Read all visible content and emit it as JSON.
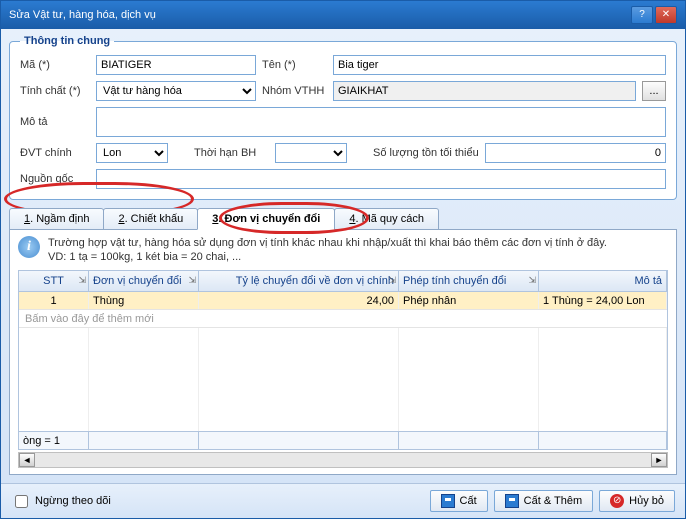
{
  "window": {
    "title": "Sửa Vật tư, hàng hóa, dịch vụ"
  },
  "group": {
    "legend": "Thông tin chung"
  },
  "fields": {
    "ma_label": "Mã (*)",
    "ma_value": "BIATIGER",
    "ten_label": "Tên (*)",
    "ten_value": "Bia tiger",
    "tinhchat_label": "Tính chất (*)",
    "tinhchat_value": "Vật tư hàng hóa",
    "nhom_label": "Nhóm VTHH",
    "nhom_value": "GIAIKHAT",
    "mota_label": "Mô tả",
    "mota_value": "",
    "dvt_label": "ĐVT chính",
    "dvt_value": "Lon",
    "thbh_label": "Thời hạn BH",
    "thbh_value": "",
    "sltt_label": "Số lượng tồn tối thiểu",
    "sltt_value": "0",
    "nguon_label": "Nguồn gốc",
    "nguon_value": ""
  },
  "tabs": {
    "t1": "1. Ngầm định",
    "t2": "2. Chiết khấu",
    "t3": "3. Đơn vị chuyển đổi",
    "t4": "4. Mã quy cách"
  },
  "info": {
    "line1": "Trường hợp vật tư, hàng hóa sử dụng đơn vị tính khác nhau khi nhập/xuất thì khai báo thêm các đơn vị tính ở đây.",
    "line2": "VD: 1 tạ = 100kg, 1 két bia = 20 chai, ..."
  },
  "grid": {
    "h_stt": "STT",
    "h_dv": "Đơn vị chuyển đổi",
    "h_tl": "Tỷ lệ chuyển đổi về đơn vị chính",
    "h_pt": "Phép tính chuyển đổi",
    "h_mt": "Mô tả",
    "r1": {
      "stt": "1",
      "dv": "Thùng",
      "tl": "24,00",
      "pt": "Phép nhân",
      "mt": "1 Thùng = 24,00 Lon"
    },
    "add_hint": "Bấm vào đây để thêm mới",
    "status": "òng = 1"
  },
  "footer": {
    "chk_label": "Ngừng theo dõi",
    "btn_save": "Cất",
    "btn_save_add": "Cất & Thêm",
    "btn_cancel": "Hủy bỏ"
  }
}
